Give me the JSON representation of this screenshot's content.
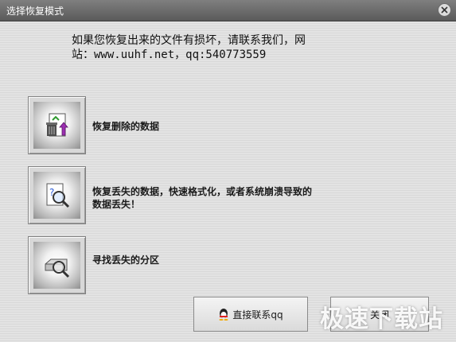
{
  "window": {
    "title": "选择恢复模式"
  },
  "message": {
    "line1": "如果您恢复出来的文件有损坏，请联系我们，网",
    "line2": "站：www.uuhf.net，qq:540773559"
  },
  "options": [
    {
      "label": "恢复删除的数据"
    },
    {
      "label_line1": "恢复丢失的数据，快速格式化，或者系统崩溃导致的",
      "label_line2": "数据丢失！"
    },
    {
      "label": "寻找丢失的分区"
    }
  ],
  "buttons": {
    "contact_qq": "直接联系qq",
    "close": "关闭"
  },
  "watermark": "极速下载站"
}
